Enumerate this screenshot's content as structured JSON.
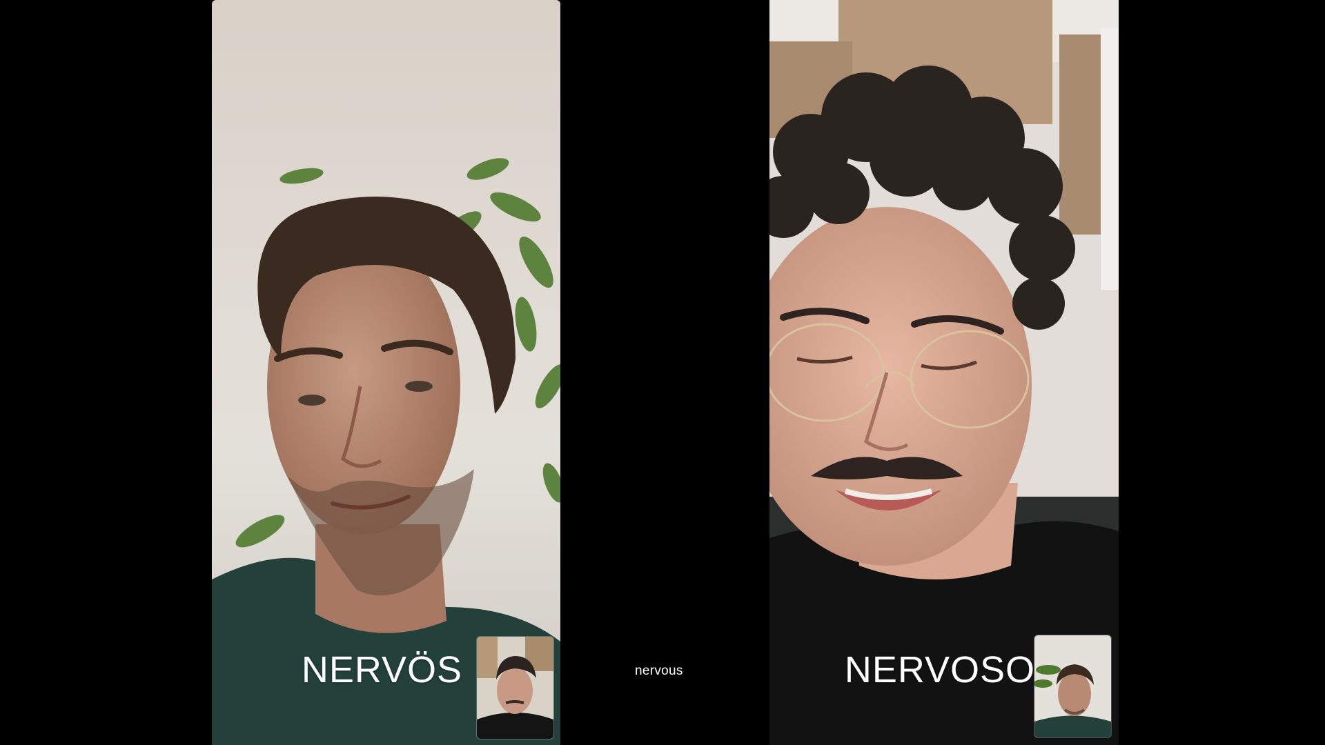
{
  "left_call": {
    "word": "NERVÖS",
    "feed_icon": "person-video-feed",
    "pip_icon": "self-view-thumbnail"
  },
  "right_call": {
    "word": "NERVOSO",
    "feed_icon": "person-video-feed",
    "pip_icon": "self-view-thumbnail"
  },
  "translation": "nervous",
  "colors": {
    "background": "#000000",
    "text": "#ffffff"
  }
}
